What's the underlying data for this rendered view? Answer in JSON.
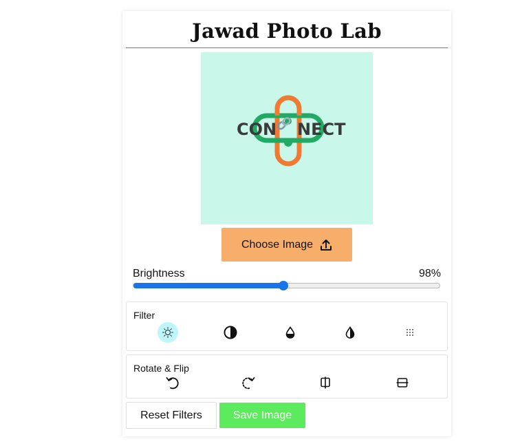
{
  "app": {
    "title": "Jawad Photo Lab"
  },
  "preview": {
    "logo_text_left": "CON",
    "logo_text_right": "NECT",
    "background_color": "#c9f8ea",
    "link_colors": {
      "orange": "#ee7a33",
      "green": "#22a964",
      "text": "#3a3a3a"
    }
  },
  "upload": {
    "label": "Choose Image",
    "icon": "upload-icon"
  },
  "slider": {
    "name": "Brightness",
    "value_text": "98%",
    "value": 49
  },
  "filter": {
    "title": "Filter",
    "options": [
      {
        "name": "brightness",
        "icon": "sun-icon",
        "active": true
      },
      {
        "name": "contrast",
        "icon": "contrast-icon",
        "active": false
      },
      {
        "name": "saturation",
        "icon": "drop-icon",
        "active": false
      },
      {
        "name": "grayscale",
        "icon": "half-drop-icon",
        "active": false
      },
      {
        "name": "blur",
        "icon": "dots-grid-icon",
        "active": false
      }
    ]
  },
  "rotate": {
    "title": "Rotate & Flip",
    "options": [
      {
        "name": "rotate-left",
        "icon": "rotate-left-icon"
      },
      {
        "name": "rotate-right",
        "icon": "rotate-right-icon"
      },
      {
        "name": "flip-horizontal",
        "icon": "flip-horizontal-icon"
      },
      {
        "name": "flip-vertical",
        "icon": "flip-vertical-icon"
      }
    ]
  },
  "actions": {
    "reset_label": "Reset Filters",
    "save_label": "Save Image"
  },
  "colors": {
    "accent": "#1a73e8",
    "choose_bg": "#f7ae6b",
    "save_bg": "#5ceb5c",
    "active_filter_bg": "#bff6fb"
  }
}
